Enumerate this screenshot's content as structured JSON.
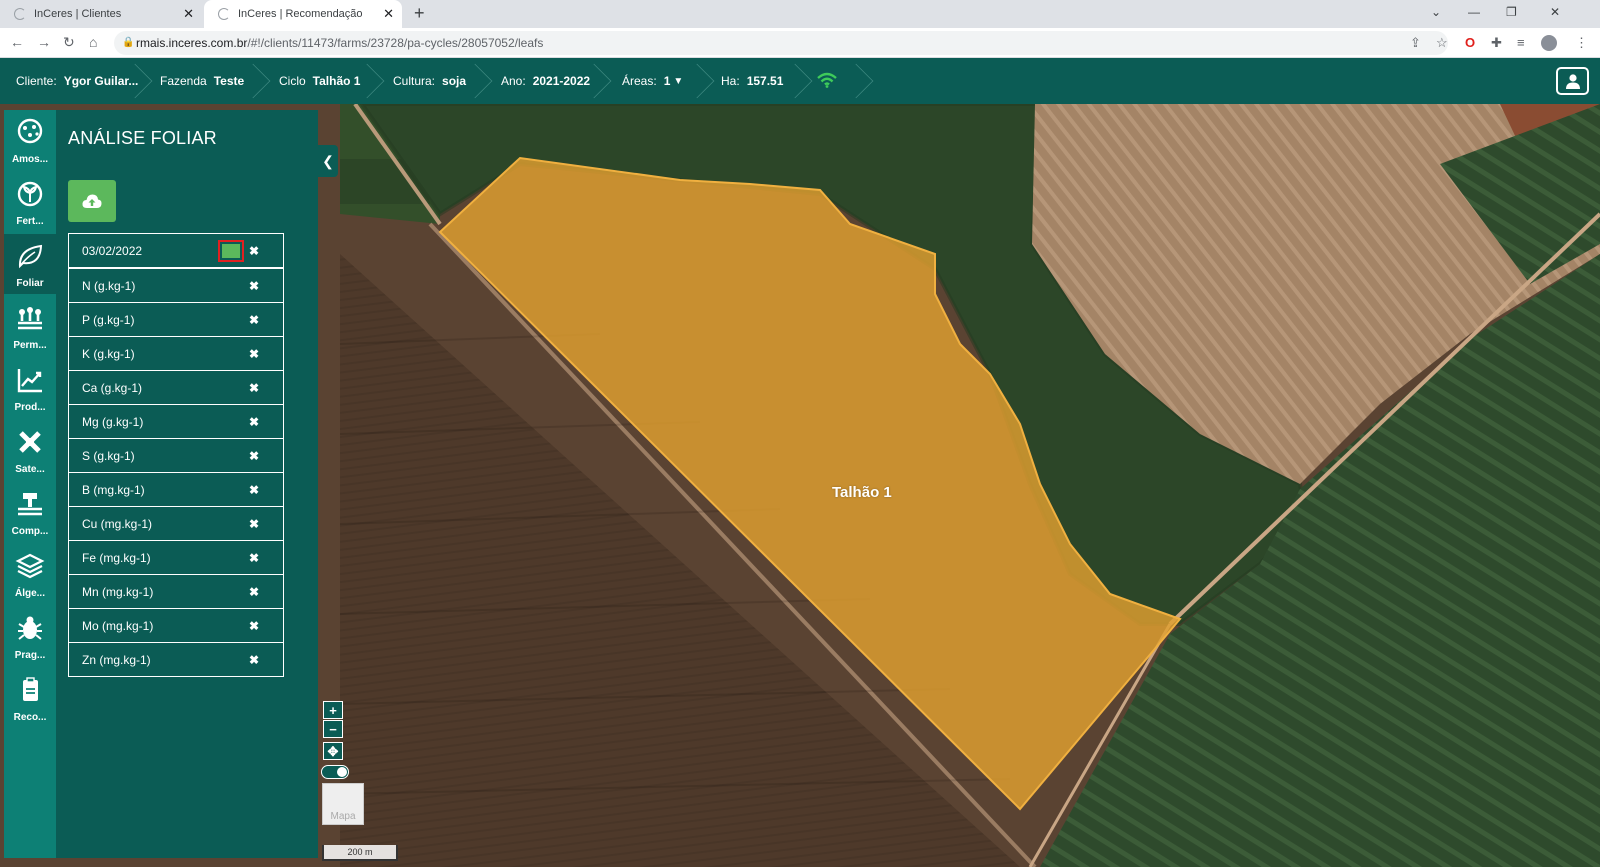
{
  "browser": {
    "tabs": [
      {
        "title": "InCeres | Clientes",
        "close": "✕"
      },
      {
        "title": "InCeres | Recomendação",
        "close": "✕"
      }
    ],
    "new_tab": "+",
    "window_controls": {
      "collapse": "⌄",
      "minimize": "—",
      "restore": "❐",
      "close": "✕"
    },
    "nav": {
      "back": "←",
      "forward": "→",
      "reload": "↻",
      "home": "⌂"
    },
    "url_host": "rmais.inceres.com.br",
    "url_path": "/#!/clients/11473/farms/23728/pa-cycles/28057052/leafs"
  },
  "header": {
    "cliente_label": "Cliente:",
    "cliente_value": "Ygor Guilar...",
    "fazenda_label": "Fazenda",
    "fazenda_value": "Teste",
    "ciclo_label": "Ciclo",
    "ciclo_value": "Talhão 1",
    "cultura_label": "Cultura:",
    "cultura_value": "soja",
    "ano_label": "Ano:",
    "ano_value": "2021-2022",
    "areas_label": "Áreas:",
    "areas_value": "1",
    "ha_label": "Ha:",
    "ha_value": "157.51"
  },
  "rail": [
    {
      "label": "Amos...",
      "icon": "sampling-icon"
    },
    {
      "label": "Fert...",
      "icon": "fertility-icon"
    },
    {
      "label": "Foliar",
      "icon": "leaf-icon",
      "active": true
    },
    {
      "label": "Perm...",
      "icon": "permanent-crop-icon"
    },
    {
      "label": "Prod...",
      "icon": "productivity-chart-icon"
    },
    {
      "label": "Sate...",
      "icon": "satellite-icon"
    },
    {
      "label": "Comp...",
      "icon": "compaction-icon"
    },
    {
      "label": "Álge...",
      "icon": "layers-icon"
    },
    {
      "label": "Prag...",
      "icon": "bug-icon"
    },
    {
      "label": "Reco...",
      "icon": "recommendation-icon"
    }
  ],
  "panel": {
    "title": "ANÁLISE FOLIAR",
    "date": "03/02/2022",
    "delete": "✖",
    "items": [
      "N (g.kg-1)",
      "P (g.kg-1)",
      "K (g.kg-1)",
      "Ca (g.kg-1)",
      "Mg (g.kg-1)",
      "S (g.kg-1)",
      "B (mg.kg-1)",
      "Cu (mg.kg-1)",
      "Fe (mg.kg-1)",
      "Mn (mg.kg-1)",
      "Mo (mg.kg-1)",
      "Zn (mg.kg-1)"
    ]
  },
  "map": {
    "field_label": "Talhão 1",
    "zoom_in": "+",
    "zoom_out": "−",
    "basemap_label": "Mapa",
    "scale": "200 m"
  },
  "colors": {
    "primary": "#0b5c55",
    "rail": "#0d8075",
    "upload": "#5cb85c",
    "field": "#e0a030",
    "highlight": "#e02020"
  }
}
